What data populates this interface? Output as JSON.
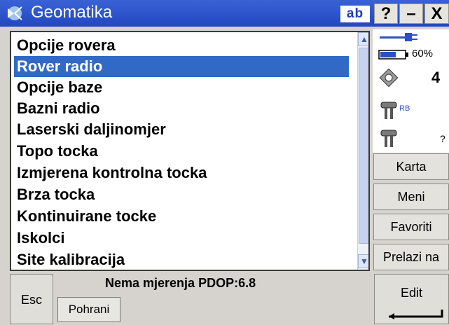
{
  "window": {
    "title": "Geomatika",
    "input_mode": "ab"
  },
  "title_buttons": {
    "help": "?",
    "minimize": "–",
    "close": "X"
  },
  "menu": {
    "items": [
      "Opcije rovera",
      "Rover radio",
      "Opcije baze",
      "Bazni radio",
      "Laserski daljinomjer",
      "Topo tocka",
      "Izmjerena kontrolna tocka",
      "Brza tocka",
      "Kontinuirane tocke",
      "Iskolci",
      "Site kalibracija"
    ],
    "selected_index": 1
  },
  "status": {
    "battery_percent": "60%",
    "satellites": "4",
    "rover_label": "RB",
    "base_label": "?"
  },
  "side_buttons": {
    "map": "Karta",
    "menu": "Meni",
    "favorites": "Favoriti",
    "switch": "Prelazi na"
  },
  "bottom": {
    "esc": "Esc",
    "status_message": "Nema mjerenja  PDOP:6.8",
    "store": "Pohrani",
    "edit": "Edit"
  },
  "colors": {
    "titlebar": "#2a4fc8",
    "selection": "#3169c6"
  }
}
